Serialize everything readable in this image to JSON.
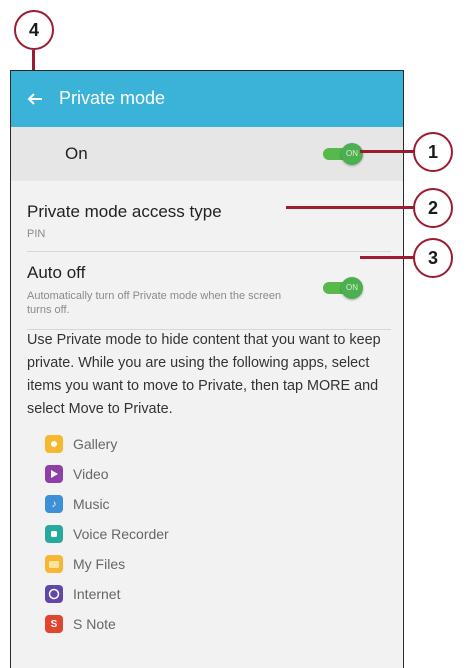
{
  "titlebar": {
    "title": "Private mode",
    "back_icon": "arrow-left-icon",
    "color": "#3bb3d9"
  },
  "on_row": {
    "label": "On",
    "toggle_text": "ON",
    "state": true
  },
  "access_type": {
    "title": "Private mode access type",
    "value": "PIN"
  },
  "auto_off": {
    "title": "Auto off",
    "description_line1": "Automatically turn off Private mode when the screen",
    "description_line2": "turns off.",
    "toggle_text": "ON",
    "state": true
  },
  "info_text": "Use Private mode to hide content that you want to keep private. While you are using the following apps, select items you want to move to Private, then tap MORE and select Move to Private.",
  "apps": [
    {
      "name": "Gallery",
      "icon": "gallery-icon",
      "color": "#f5b82e"
    },
    {
      "name": "Video",
      "icon": "video-icon",
      "color": "#8e3fa8"
    },
    {
      "name": "Music",
      "icon": "music-icon",
      "color": "#3f8fd8"
    },
    {
      "name": "Voice Recorder",
      "icon": "voice-recorder-icon",
      "color": "#27a9a0"
    },
    {
      "name": "My Files",
      "icon": "my-files-icon",
      "color": "#f7b733"
    },
    {
      "name": "Internet",
      "icon": "internet-icon",
      "color": "#6247aa"
    },
    {
      "name": "S Note",
      "icon": "s-note-icon",
      "color": "#e0452f"
    }
  ],
  "callouts": {
    "c1": "1",
    "c2": "2",
    "c3": "3",
    "c4": "4",
    "color": "#9b1b30"
  }
}
